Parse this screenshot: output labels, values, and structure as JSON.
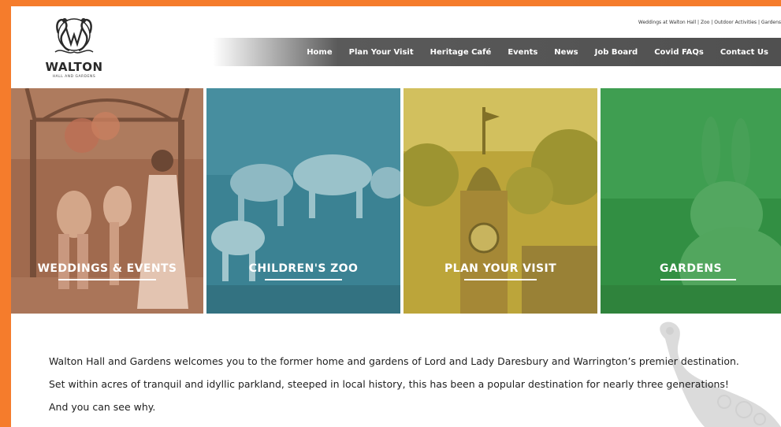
{
  "logo": {
    "name": "WALTON",
    "subtitle": "HALL AND GARDENS",
    "icon": "peacock-monogram-icon"
  },
  "top_links": "Weddings at Walton Hall | Zoo | Outdoor Activities | Gardens",
  "nav": [
    {
      "label": "Home"
    },
    {
      "label": "Plan Your Visit"
    },
    {
      "label": "Heritage Café"
    },
    {
      "label": "Events"
    },
    {
      "label": "News"
    },
    {
      "label": "Job Board"
    },
    {
      "label": "Covid FAQs"
    },
    {
      "label": "Contact Us"
    }
  ],
  "tiles": [
    {
      "label": "WEDDINGS & EVENTS",
      "tint": "#c98a6a"
    },
    {
      "label": "CHILDREN'S ZOO",
      "tint": "#3f8a9c"
    },
    {
      "label": "PLAN YOUR VISIT",
      "tint": "#c9b33a"
    },
    {
      "label": "GARDENS",
      "tint": "#3fa054"
    }
  ],
  "intro": "Walton Hall and Gardens welcomes you to the former home and gardens of Lord and Lady Daresbury and Warrington’s premier destination. Set within acres of tranquil and idyllic parkland, steeped in local history, this has been a popular destination for nearly three generations! And you can see why.",
  "colors": {
    "frame": "#f57c2c",
    "nav_bg": "#505050"
  }
}
